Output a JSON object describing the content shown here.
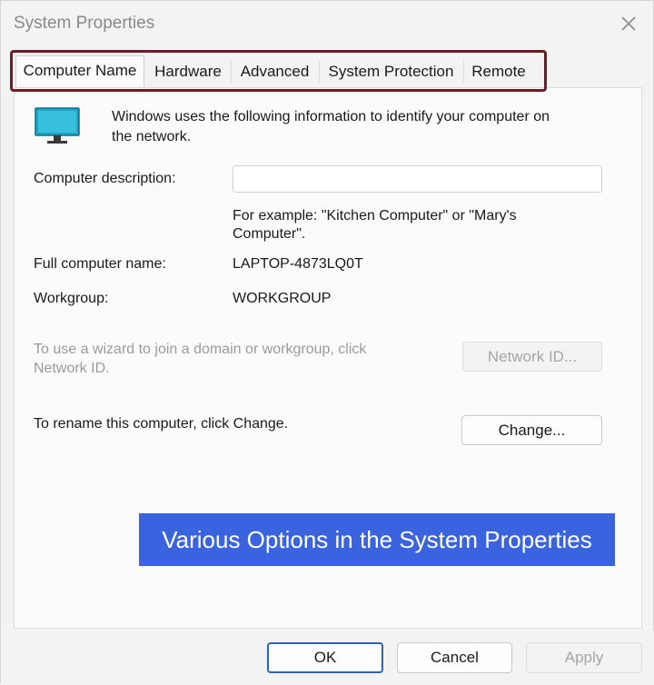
{
  "window": {
    "title": "System Properties",
    "close_icon": "close-icon"
  },
  "tabs": [
    {
      "label": "Computer Name",
      "active": true
    },
    {
      "label": "Hardware",
      "active": false
    },
    {
      "label": "Advanced",
      "active": false
    },
    {
      "label": "System Protection",
      "active": false
    },
    {
      "label": "Remote",
      "active": false
    }
  ],
  "colors": {
    "tab_highlight": "#6e1b26",
    "banner": "#3a63e0",
    "monitor": "#1ea5c6"
  },
  "panel": {
    "intro_line1": "Windows uses the following information to identify your computer on",
    "intro_line2": "the network.",
    "description_label": "Computer description:",
    "description_value": "",
    "example_line1": "For example: \"Kitchen Computer\" or \"Mary's",
    "example_line2": "Computer\".",
    "full_name_label": "Full computer name:",
    "full_name_value": "LAPTOP-4873LQ0T",
    "workgroup_label": "Workgroup:",
    "workgroup_value": "WORKGROUP",
    "wizard_line1": "To use a wizard to join a domain or workgroup, click",
    "wizard_line2": "Network ID.",
    "network_id_button": "Network ID...",
    "rename_text": "To rename this computer, click Change.",
    "change_button": "Change..."
  },
  "banner": {
    "text": "Various Options in the System Properties"
  },
  "footer": {
    "ok": "OK",
    "cancel": "Cancel",
    "apply": "Apply"
  }
}
